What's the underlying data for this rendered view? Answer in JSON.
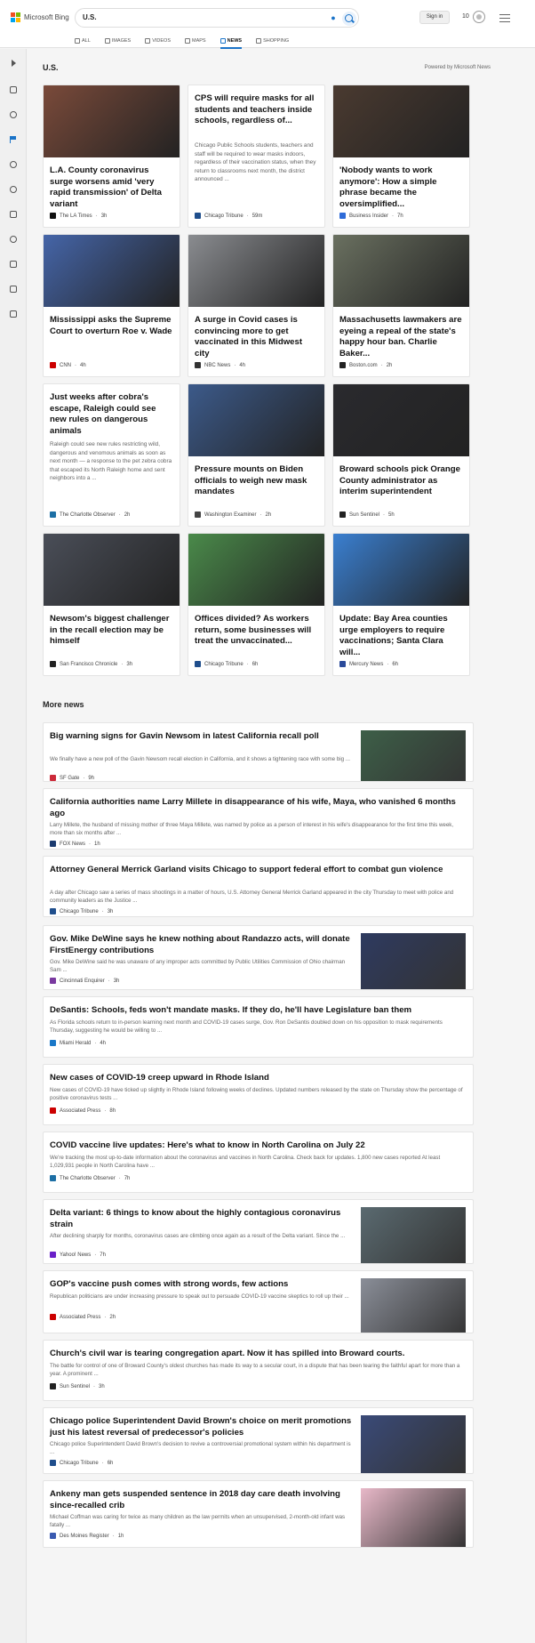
{
  "header": {
    "brand": "Microsoft Bing",
    "search_value": "U.S.",
    "signin_label": "Sign in",
    "points": "10",
    "tabs": [
      {
        "label": "ALL",
        "icon": "search-icon"
      },
      {
        "label": "IMAGES",
        "icon": "image-icon"
      },
      {
        "label": "VIDEOS",
        "icon": "video-icon"
      },
      {
        "label": "MAPS",
        "icon": "map-pin-icon"
      },
      {
        "label": "NEWS",
        "icon": "news-icon",
        "active": true
      },
      {
        "label": "SHOPPING",
        "icon": "shopping-tag-icon"
      }
    ]
  },
  "section": {
    "title": "U.S.",
    "powered_by": "Powered by Microsoft News"
  },
  "cards": [
    {
      "headline": "L.A. County coronavirus surge worsens amid 'very rapid transmission' of Delta variant",
      "source": "The LA Times",
      "time": "3h",
      "has_image": true,
      "image_color": "#7a4a3a",
      "source_color": "#111111"
    },
    {
      "headline": "CPS will require masks for all students and teachers inside schools, regardless of...",
      "excerpt": "Chicago Public Schools students, teachers and staff will be required to wear masks indoors, regardless of their vaccination status, when they return to classrooms next month, the district announced ...",
      "source": "Chicago Tribune",
      "time": "59m",
      "has_image": false,
      "source_color": "#1f4e8c"
    },
    {
      "headline": "'Nobody wants to work anymore': How a simple phrase became the oversimplified...",
      "source": "Business Insider",
      "time": "7h",
      "has_image": true,
      "image_color": "#4a3a30",
      "source_color": "#2e6bd8"
    },
    {
      "headline": "Mississippi asks the Supreme Court to overturn Roe v. Wade",
      "source": "CNN",
      "time": "4h",
      "has_image": true,
      "image_color": "#4565a8",
      "source_color": "#cc0000"
    },
    {
      "headline": "A surge in Covid cases is convincing more to get vaccinated in this Midwest city",
      "source": "NBC News",
      "time": "4h",
      "has_image": true,
      "image_color": "#8a8c90",
      "source_color": "#333333"
    },
    {
      "headline": "Massachusetts lawmakers are eyeing a repeal of the state's happy hour ban. Charlie Baker...",
      "source": "Boston.com",
      "time": "2h",
      "has_image": true,
      "image_color": "#6a7060",
      "source_color": "#222222"
    },
    {
      "headline": "Just weeks after cobra's escape, Raleigh could see new rules on dangerous animals",
      "excerpt": "Raleigh could see new rules restricting wild, dangerous and venomous animals as soon as next month — a response to the pet zebra cobra that escaped its North Raleigh home and sent neighbors into a ...",
      "source": "The Charlotte Observer",
      "time": "2h",
      "has_image": false,
      "source_color": "#1d6fa5"
    },
    {
      "headline": "Pressure mounts on Biden officials to weigh new mask mandates",
      "source": "Washington Examiner",
      "time": "2h",
      "has_image": true,
      "image_color": "#3c5a8a",
      "source_color": "#444444"
    },
    {
      "headline": "Broward schools pick Orange County administrator as interim superintendent",
      "source": "Sun Sentinel",
      "time": "5h",
      "has_image": true,
      "image_color": "#2a2a2e",
      "source_color": "#222222"
    },
    {
      "headline": "Newsom's biggest challenger in the recall election may be himself",
      "source": "San Francisco Chronicle",
      "time": "3h",
      "has_image": true,
      "image_color": "#4a4e58",
      "source_color": "#222222"
    },
    {
      "headline": "Offices divided? As workers return, some businesses will treat the unvaccinated...",
      "source": "Chicago Tribune",
      "time": "6h",
      "has_image": true,
      "image_color": "#4a8a4a",
      "source_color": "#1f4e8c"
    },
    {
      "headline": "Update: Bay Area counties urge employers to require vaccinations; Santa Clara will...",
      "source": "Mercury News",
      "time": "6h",
      "has_image": true,
      "image_color": "#3a7fd0",
      "source_color": "#2a4a9a"
    }
  ],
  "more": {
    "title": "More news",
    "items": [
      {
        "headline": "Big warning signs for Gavin Newsom in latest California recall poll",
        "excerpt": "We finally have a new poll of the Gavin Newsom recall election in California, and it shows a tightening race with some big ...",
        "source": "SF Gate",
        "time": "9h",
        "has_image": true,
        "image_color": "#3d5f48",
        "source_color": "#cc2a3a"
      },
      {
        "headline": "California authorities name Larry Millete in disappearance of his wife, Maya, who vanished 6 months ago",
        "excerpt": "Larry Millete, the husband of missing mother of three Maya Millete, was named by police as a person of interest in his wife's disappearance for the first time this week, more than six months after ...",
        "source": "FOX News",
        "time": "1h",
        "has_image": false,
        "source_color": "#1a3a6e"
      },
      {
        "headline": "Attorney General Merrick Garland visits Chicago to support federal effort to combat gun violence",
        "excerpt": "A day after Chicago saw a series of mass shootings in a matter of hours, U.S. Attorney General Merrick Garland appeared in the city Thursday to meet with police and community leaders as the Justice ...",
        "source": "Chicago Tribune",
        "time": "3h",
        "has_image": false,
        "source_color": "#1f4e8c"
      },
      {
        "headline": "Gov. Mike DeWine says he knew nothing about Randazzo acts, will donate FirstEnergy contributions",
        "excerpt": "Gov. Mike DeWine said he was unaware of any improper acts committed by Public Utilities Commission of Ohio chairman Sam ...",
        "source": "Cincinnati Enquirer",
        "time": "3h",
        "has_image": true,
        "image_color": "#2e3a60",
        "source_color": "#7a3aa0"
      },
      {
        "headline": "DeSantis: Schools, feds won't mandate masks. If they do, he'll have Legislature ban them",
        "excerpt": "As Florida schools return to in-person learning next month and COVID-19 cases surge, Gov. Ron DeSantis doubled down on his opposition to mask requirements Thursday, suggesting he would be willing to ...",
        "source": "Miami Herald",
        "time": "4h",
        "has_image": false,
        "source_color": "#1a78c8"
      },
      {
        "headline": "New cases of COVID-19 creep upward in Rhode Island",
        "excerpt": "New cases of COVID-19 have ticked up slightly in Rhode Island following weeks of declines. Updated numbers released by the state on Thursday show the percentage of positive coronavirus tests ...",
        "source": "Associated Press",
        "time": "8h",
        "has_image": false,
        "source_color": "#cc0000"
      },
      {
        "headline": "COVID vaccine live updates: Here's what to know in North Carolina on July 22",
        "excerpt": "We're tracking the most up-to-date information about the coronavirus and vaccines in North Carolina. Check back for updates. 1,800 new cases reported At least 1,029,931 people in North Carolina have ...",
        "source": "The Charlotte Observer",
        "time": "7h",
        "has_image": false,
        "source_color": "#1d6fa5"
      },
      {
        "headline": "Delta variant: 6 things to know about the highly contagious coronavirus strain",
        "excerpt": "After declining sharply for months, coronavirus cases are climbing once again as a result of the Delta variant. Since the ...",
        "source": "Yahoo! News",
        "time": "7h",
        "has_image": true,
        "image_color": "#5a6a70",
        "source_color": "#6a1fc8"
      },
      {
        "headline": "GOP's vaccine push comes with strong words, few actions",
        "excerpt": "Republican politicians are under increasing pressure to speak out to persuade COVID-19 vaccine skeptics to roll up their ...",
        "source": "Associated Press",
        "time": "2h",
        "has_image": true,
        "image_color": "#8a8e98",
        "source_color": "#cc0000"
      },
      {
        "headline": "Church's civil war is tearing congregation apart. Now it has spilled into Broward courts.",
        "excerpt": "The battle for control of one of Broward County's oldest churches has made its way to a secular court, in a dispute that has been tearing the faithful apart for more than a year. A prominent ...",
        "source": "Sun Sentinel",
        "time": "3h",
        "has_image": false,
        "source_color": "#222222"
      },
      {
        "headline": "Chicago police Superintendent David Brown's choice on merit promotions just his latest reversal of predecessor's policies",
        "excerpt": "Chicago police Superintendent David Brown's decision to revive a controversial promotional system within his department is ...",
        "source": "Chicago Tribune",
        "time": "6h",
        "has_image": true,
        "image_color": "#3a4a78",
        "source_color": "#1f4e8c"
      },
      {
        "headline": "Ankeny man gets suspended sentence in 2018 day care death involving since-recalled crib",
        "excerpt": "Michael Coffman was caring for twice as many children as the law permits when an unsupervised, 2-month-old infant was fatally ...",
        "source": "Des Moines Register",
        "time": "1h",
        "has_image": true,
        "image_color": "#e8b8c8",
        "source_color": "#3a5ab0"
      }
    ]
  }
}
